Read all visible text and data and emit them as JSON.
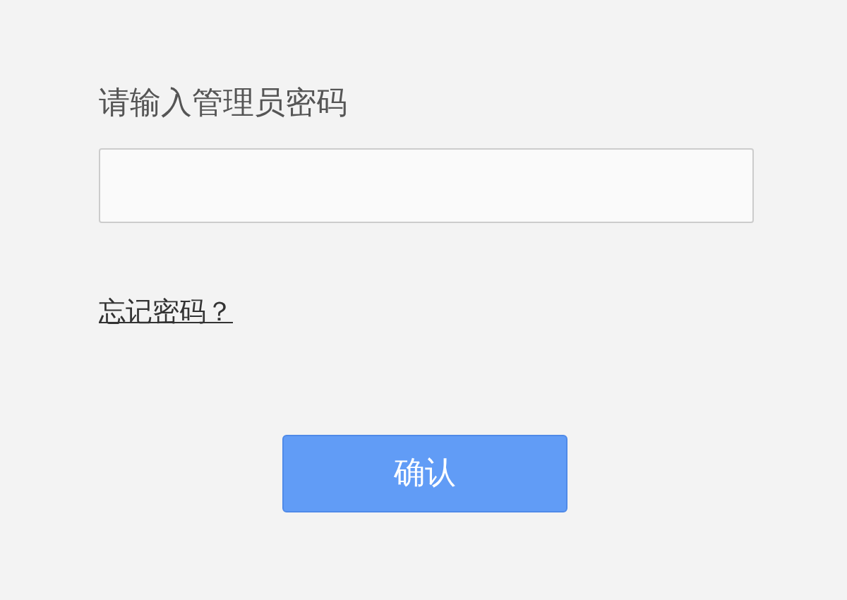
{
  "password_field": {
    "label": "请输入管理员密码"
  },
  "forgot_link": "忘记密码？",
  "confirm_button": "确认"
}
